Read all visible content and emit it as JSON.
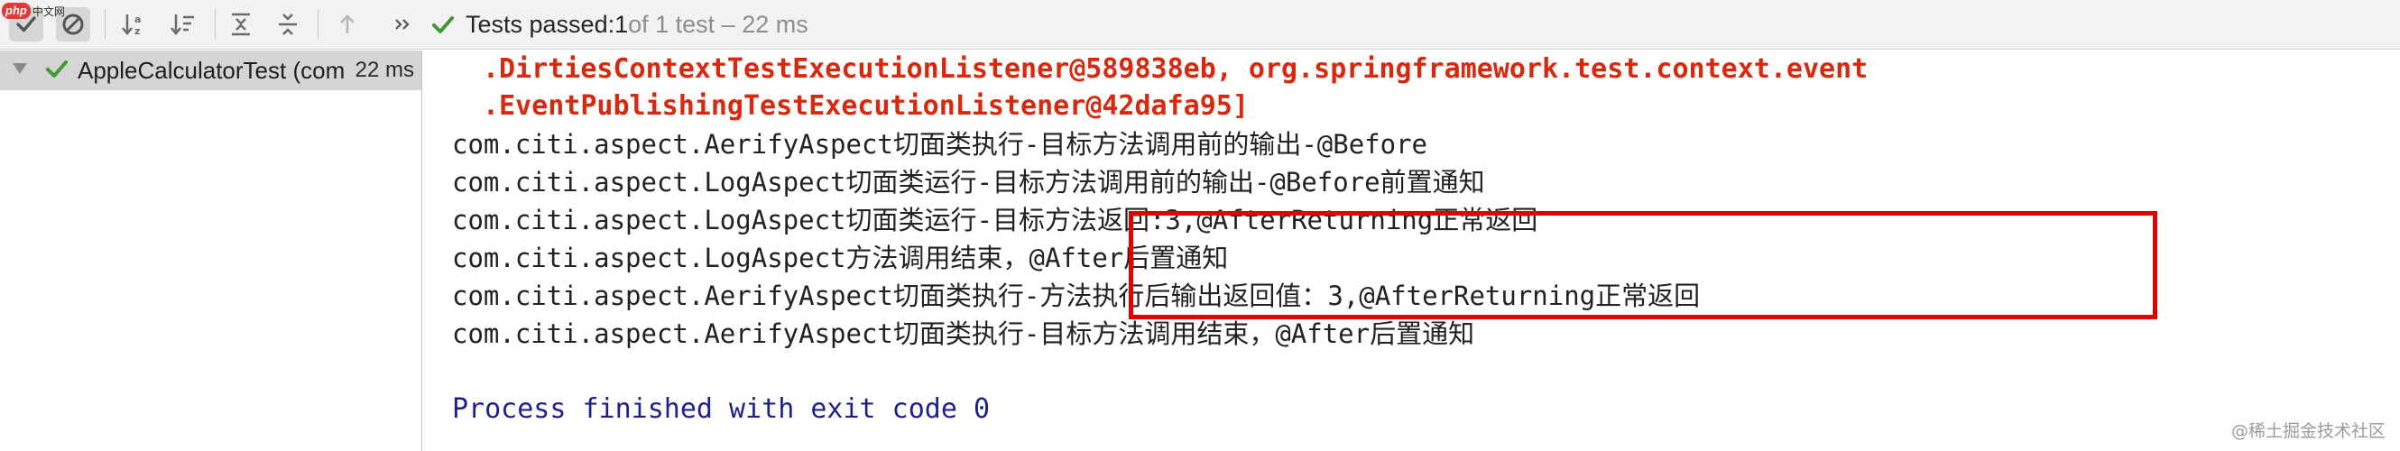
{
  "watermark": {
    "badge": "php",
    "text": "中文网"
  },
  "toolbar": {
    "icons": [
      "check-icon",
      "stop-icon",
      "sort-alpha-icon",
      "sort-duration-icon",
      "expand-all-icon",
      "collapse-all-icon",
      "previous-failed-icon",
      "more-icon"
    ],
    "status": {
      "prefix": "Tests passed: ",
      "passed": "1",
      "suffix": " of 1 test – 22 ms"
    }
  },
  "tree": {
    "item": {
      "label": "AppleCalculatorTest (com",
      "time": "22 ms"
    }
  },
  "console": {
    "lines": [
      ".DirtiesContextTestExecutionListener@589838eb, org.springframework.test.context.event",
      ".EventPublishingTestExecutionListener@42dafa95]",
      "com.citi.aspect.AerifyAspect切面类执行-目标方法调用前的输出-@Before",
      "com.citi.aspect.LogAspect切面类运行-目标方法调用前的输出-@Before前置通知",
      "com.citi.aspect.LogAspect切面类运行-目标方法返回:3,@AfterReturning正常返回",
      "com.citi.aspect.LogAspect方法调用结束，@After后置通知",
      "com.citi.aspect.AerifyAspect切面类执行-方法执行后输出返回值：3,@AfterReturning正常返回",
      "com.citi.aspect.AerifyAspect切面类执行-目标方法调用结束，@After后置通知",
      "",
      "Process finished with exit code 0"
    ]
  },
  "credit": "@稀土掘金技术社区",
  "colors": {
    "error": "#d8290f",
    "process": "#1f1f8f",
    "pass": "#3c9a2e",
    "highlight": "#e00000"
  }
}
